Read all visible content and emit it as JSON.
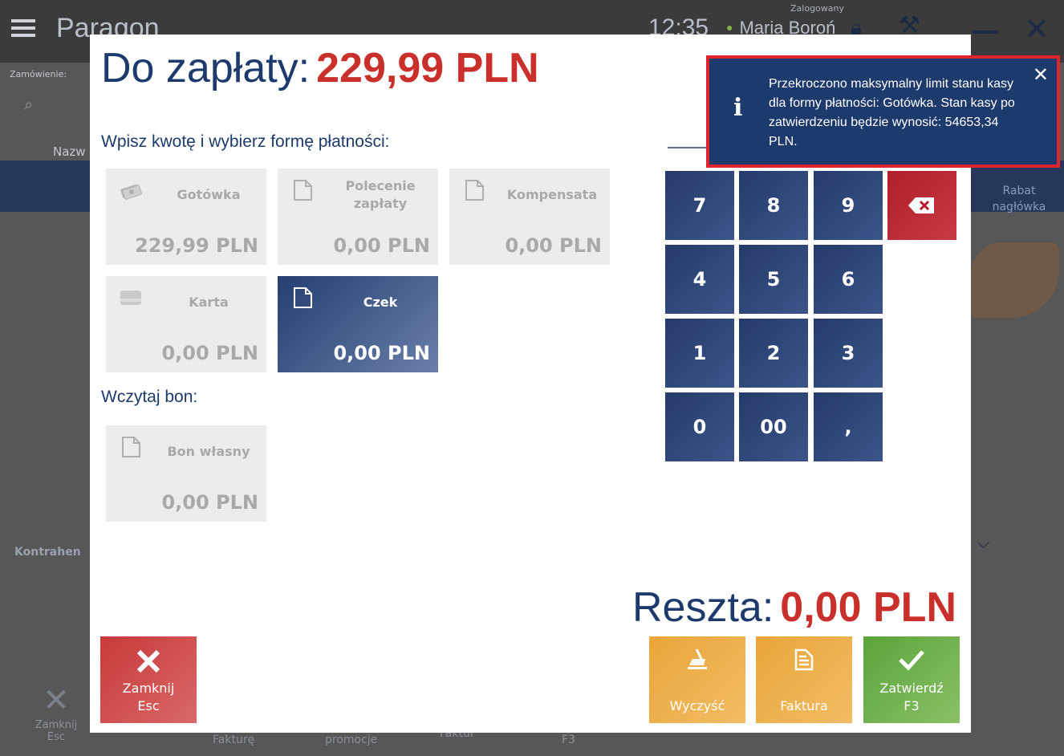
{
  "background": {
    "app_title": "Paragon",
    "time": "12:35",
    "logged_label": "Zalogowany",
    "user": "Maria Boroń",
    "order_label": "Zamówienie:",
    "name_label": "Nazw",
    "rabat_label": "Rabat nagłówka",
    "kontrahent_label": "Kontrahen",
    "close_label": "Zamknij",
    "close_key": "Esc",
    "bottom_items": [
      "Fakturę",
      "promocje",
      "Faktur",
      "F3"
    ]
  },
  "dialog": {
    "title_label": "Do zapłaty:",
    "title_amount": "229,99 PLN",
    "payment_prompt": "Wpisz kwotę i wybierz formę płatności:",
    "voucher_prompt": "Wczytaj bon:",
    "payment_tiles": [
      {
        "name": "Gotówka",
        "value": "229,99 PLN",
        "icon": "cash-icon",
        "active": false
      },
      {
        "name": "Polecenie zapłaty",
        "value": "0,00 PLN",
        "icon": "document-icon",
        "active": false
      },
      {
        "name": "Kompensata",
        "value": "0,00 PLN",
        "icon": "document-icon",
        "active": false
      },
      {
        "name": "Karta",
        "value": "0,00 PLN",
        "icon": "card-icon",
        "active": false
      },
      {
        "name": "Czek",
        "value": "0,00 PLN",
        "icon": "document-icon",
        "active": true
      }
    ],
    "voucher_tile": {
      "name": "Bon własny",
      "value": "0,00 PLN",
      "icon": "document-icon"
    },
    "keypad": [
      "7",
      "8",
      "9",
      "4",
      "5",
      "6",
      "1",
      "2",
      "3",
      "0",
      "00",
      ","
    ],
    "change_label": "Reszta:",
    "change_amount": "0,00 PLN",
    "buttons": {
      "close_label": "Zamknij",
      "close_key": "Esc",
      "clear_label": "Wyczyść",
      "invoice_label": "Faktura",
      "confirm_label": "Zatwierdź",
      "confirm_key": "F3"
    }
  },
  "notification": {
    "icon": "info-icon",
    "message": "Przekroczono maksymalny limit stanu kasy dla formy płatności: Gotówka. Stan kasy po zatwierdzeniu będzie wynosić: 54653,34 PLN."
  },
  "colors": {
    "navy": "#1d3a6c",
    "amount_red": "#c9302c",
    "tile_gray": "#ececec",
    "active_tile": "#253f71",
    "delete_red": "#b01e2b",
    "close_red": "#c73a3a",
    "orange": "#e9a53a",
    "green": "#5aa43a",
    "toast_border": "#e0252e"
  }
}
